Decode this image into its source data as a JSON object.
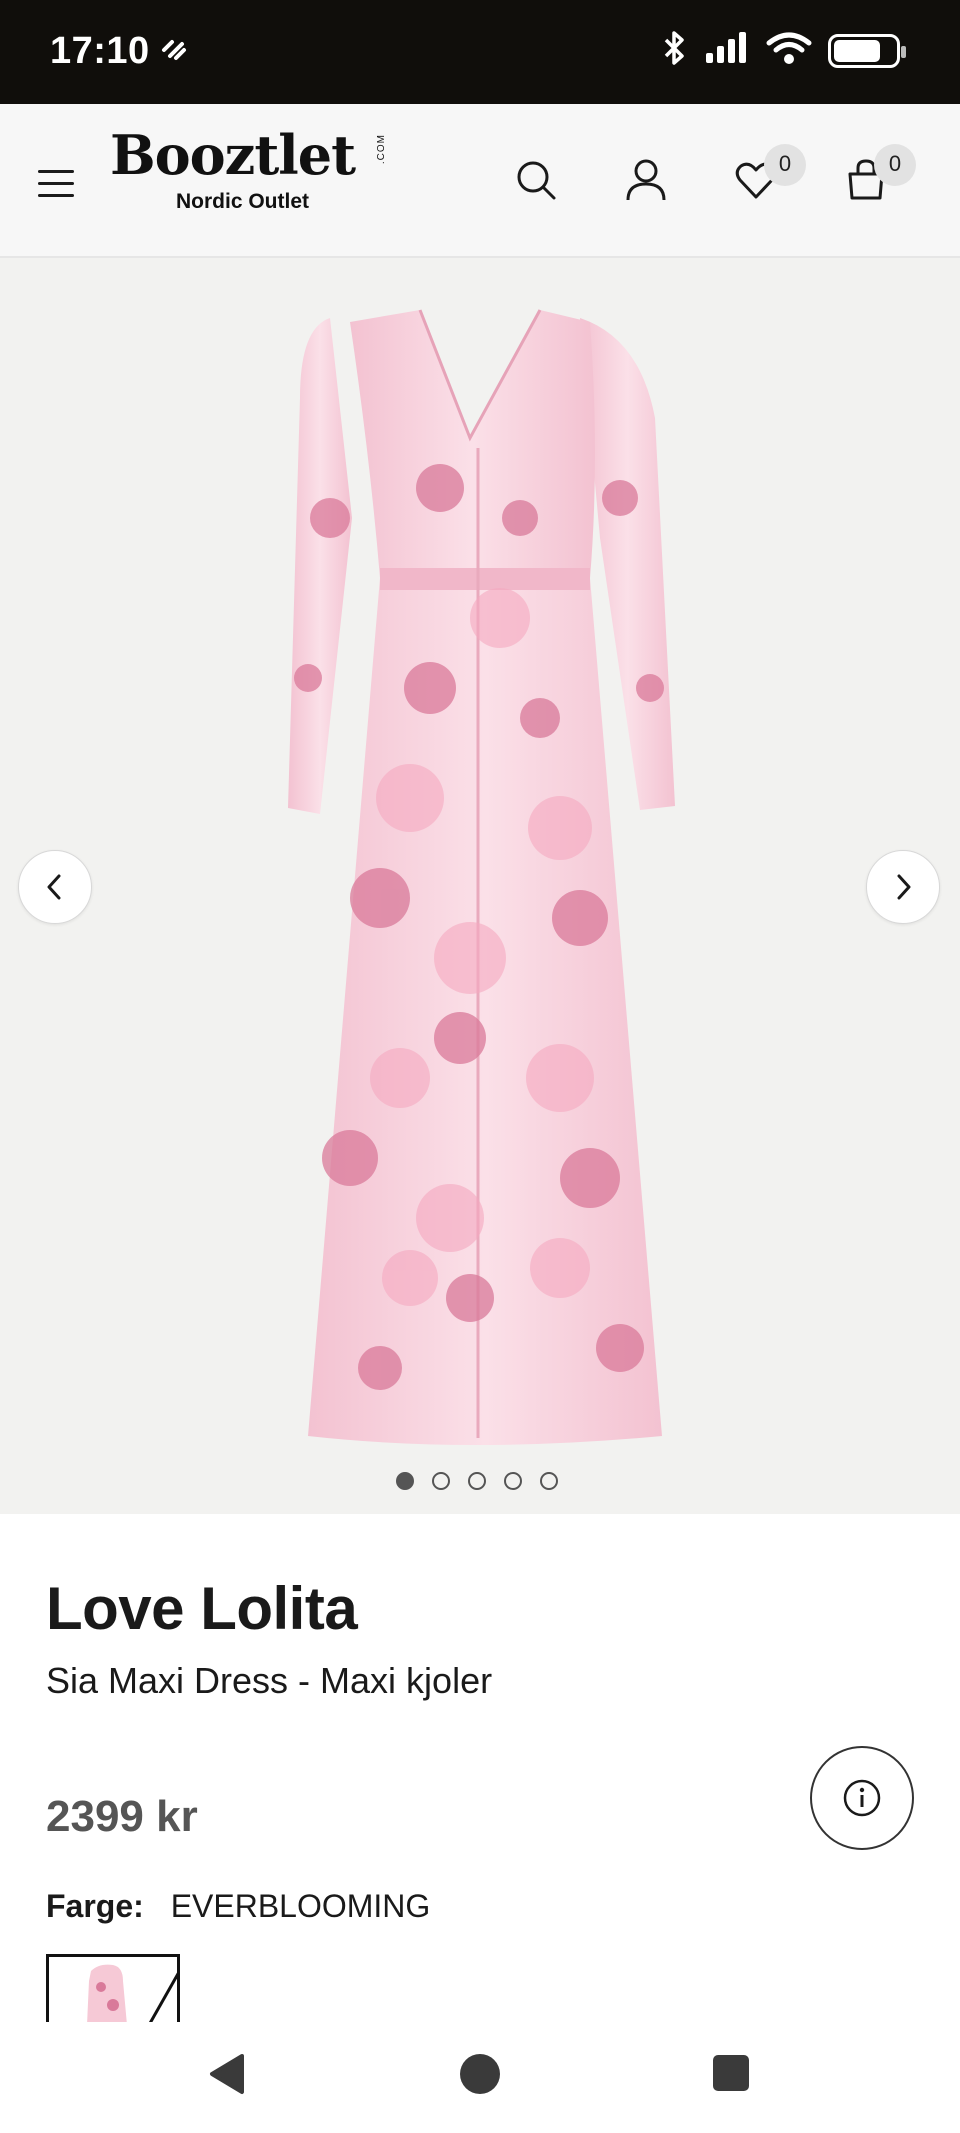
{
  "status_bar": {
    "time": "17:10",
    "extra_icon": "signal-tag-icon",
    "icons": [
      "bluetooth-icon",
      "cellular-signal-icon",
      "wifi-icon",
      "battery-icon"
    ]
  },
  "header": {
    "logo_text": "Booztlet",
    "logo_suffix": ".COM",
    "logo_subtitle": "Nordic Outlet",
    "wishlist_count": "0",
    "cart_count": "0",
    "icons": [
      "menu-icon",
      "search-icon",
      "user-icon",
      "heart-icon",
      "shopping-bag-icon"
    ]
  },
  "gallery": {
    "image_alt": "Sia Maxi Dress",
    "image_count": 5,
    "active_index": 0
  },
  "product": {
    "brand": "Love Lolita",
    "name": "Sia Maxi Dress - Maxi kjoler",
    "price": "2399 kr",
    "color_label": "Farge:",
    "color_value": "EVERBLOOMING"
  },
  "colors": {
    "status_bar_bg": "#100e0b",
    "header_bg": "#f7f7f7",
    "gallery_bg": "#f2f2f0",
    "price_text": "#555555",
    "dress_pink": "#f6c9d6",
    "flower_pink": "#d97a9a"
  },
  "nav_bar": {
    "icons": [
      "back-triangle-icon",
      "home-circle-icon",
      "recents-square-icon"
    ]
  }
}
